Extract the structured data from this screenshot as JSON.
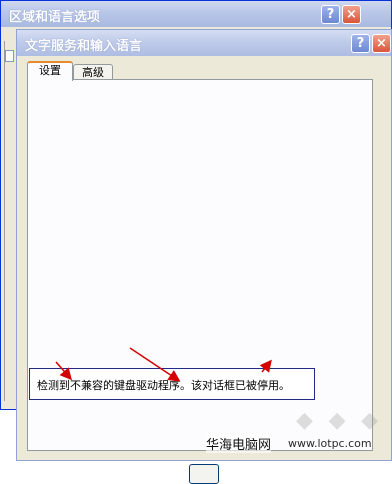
{
  "back_window": {
    "title": "区域和语言选项"
  },
  "front_window": {
    "title": "文字服务和输入语言",
    "tabs": [
      {
        "label": "设置",
        "selected": true
      },
      {
        "label": "高级",
        "selected": false
      }
    ],
    "message": "检测到不兼容的键盘驱动程序。该对话框已被停用。"
  },
  "title_buttons": {
    "help": "?",
    "close": "×"
  },
  "watermark": {
    "site_name": "华海电脑网",
    "url": "www.lotpc.com"
  },
  "colors": {
    "annotation_arrow": "#d40000",
    "message_border": "#1f2a8a",
    "selected_tab_accent": "#e68b2c"
  }
}
